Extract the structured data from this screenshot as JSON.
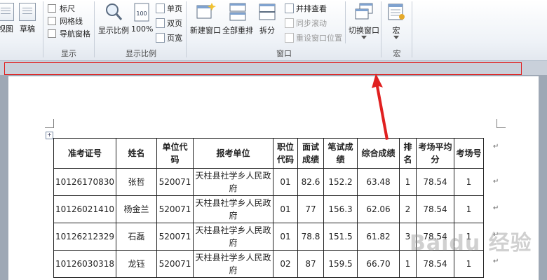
{
  "ribbon": {
    "view_buttons": [
      {
        "label": "视图"
      },
      {
        "label": "草稿"
      }
    ],
    "show_group": {
      "checkboxes": [
        {
          "label": "标尺"
        },
        {
          "label": "网格线"
        },
        {
          "label": "导航窗格"
        }
      ],
      "label": "显示"
    },
    "zoom_group": {
      "zoom_button": "显示比例",
      "percent_button": "100%",
      "page_buttons": [
        {
          "label": "单页"
        },
        {
          "label": "双页"
        },
        {
          "label": "页宽"
        }
      ],
      "label": "显示比例"
    },
    "window_group": {
      "new_window": "新建窗口",
      "arrange_all": "全部重排",
      "split": "拆分",
      "side_by_side": "并排查看",
      "sync_scroll": "同步滚动",
      "reset_position": "重设窗口位置",
      "switch_windows": "切换窗口",
      "label": "窗口"
    },
    "macro_group": {
      "macro_button": "宏",
      "label": "宏"
    }
  },
  "table": {
    "headers": [
      "准考证号",
      "姓名",
      "单位代码",
      "报考单位",
      "职位代码",
      "面试成绩",
      "笔试成绩",
      "综合成绩",
      "排名",
      "考场平均分",
      "考场号"
    ],
    "rows": [
      [
        "10126170830",
        "张哲",
        "520071",
        "天柱县社学乡人民政府",
        "01",
        "82.6",
        "152.2",
        "63.48",
        "1",
        "78.54",
        "1"
      ],
      [
        "10126021410",
        "杨金兰",
        "520071",
        "天柱县社学乡人民政府",
        "01",
        "77",
        "156.3",
        "62.06",
        "2",
        "78.54",
        "1"
      ],
      [
        "10126212329",
        "石磊",
        "520071",
        "天柱县社学乡人民政府",
        "01",
        "78.8",
        "151.5",
        "61.82",
        "3",
        "78.54",
        "1"
      ],
      [
        "10126030318",
        "龙钰",
        "520071",
        "天柱县社学乡人民政府",
        "02",
        "87",
        "159.5",
        "66.70",
        "1",
        "78.54",
        "1"
      ]
    ]
  },
  "watermark": "Baidu 经验",
  "annotation_color": "#e02020"
}
